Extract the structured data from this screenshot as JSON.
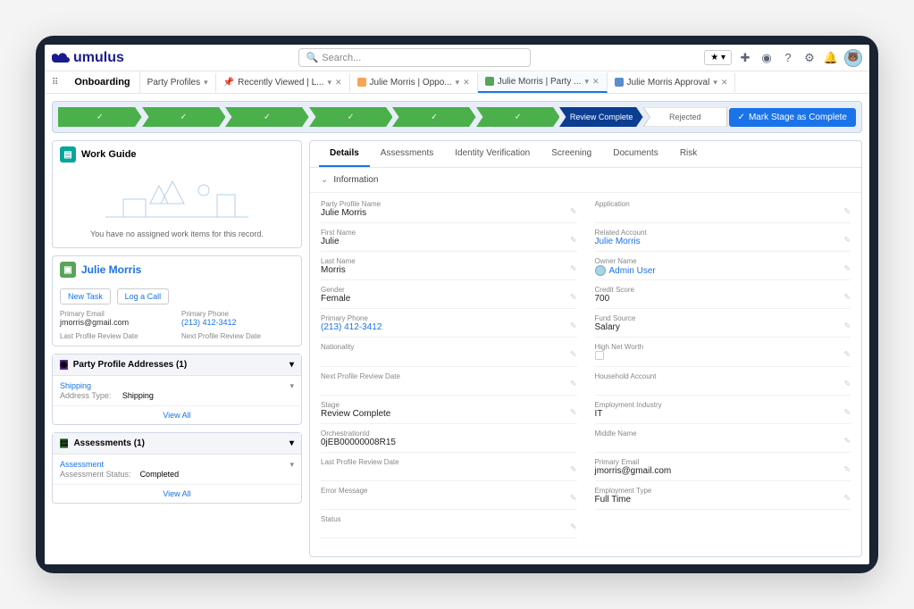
{
  "brand": "umulus",
  "search_placeholder": "Search...",
  "app_name": "Onboarding",
  "tabs": [
    {
      "label": "Party Profiles"
    },
    {
      "label": "Recently Viewed | L..."
    },
    {
      "label": "Julie Morris | Oppo..."
    },
    {
      "label": "Julie Morris | Party ..."
    },
    {
      "label": "Julie Morris Approval"
    }
  ],
  "stages": {
    "review_complete": "Review Complete",
    "rejected": "Rejected",
    "mark_complete": "Mark Stage as Complete"
  },
  "work_guide": {
    "title": "Work Guide",
    "empty": "You have no assigned work items for this record."
  },
  "contact": {
    "name": "Julie Morris",
    "new_task": "New Task",
    "log_call": "Log a Call",
    "primary_email_label": "Primary Email",
    "primary_email": "jmorris@gmail.com",
    "primary_phone_label": "Primary Phone",
    "primary_phone": "(213) 412-3412",
    "last_review_label": "Last Profile Review Date",
    "next_review_label": "Next Profile Review Date"
  },
  "addresses": {
    "title": "Party Profile Addresses (1)",
    "shipping": "Shipping",
    "addr_type_label": "Address Type:",
    "addr_type": "Shipping",
    "view_all": "View All"
  },
  "assessments": {
    "title": "Assessments (1)",
    "row_title": "Assessment",
    "status_label": "Assessment Status:",
    "status": "Completed",
    "view_all": "View All"
  },
  "detail_tabs": {
    "details": "Details",
    "assessments": "Assessments",
    "identity": "Identity Verification",
    "screening": "Screening",
    "documents": "Documents",
    "risk": "Risk"
  },
  "section_information": "Information",
  "fields": {
    "party_profile_name": {
      "label": "Party Profile Name",
      "value": "Julie Morris"
    },
    "application": {
      "label": "Application",
      "value": ""
    },
    "first_name": {
      "label": "First Name",
      "value": "Julie"
    },
    "related_account": {
      "label": "Related Account",
      "value": "Julie Morris"
    },
    "last_name": {
      "label": "Last Name",
      "value": "Morris"
    },
    "owner_name": {
      "label": "Owner Name",
      "value": "Admin User"
    },
    "gender": {
      "label": "Gender",
      "value": "Female"
    },
    "credit_score": {
      "label": "Credit Score",
      "value": "700"
    },
    "primary_phone": {
      "label": "Primary Phone",
      "value": "(213) 412-3412"
    },
    "fund_source": {
      "label": "Fund Source",
      "value": "Salary"
    },
    "nationality": {
      "label": "Nationality",
      "value": ""
    },
    "high_net_worth": {
      "label": "High Net Worth",
      "value": ""
    },
    "next_review": {
      "label": "Next Profile Review Date",
      "value": ""
    },
    "household": {
      "label": "Household Account",
      "value": ""
    },
    "stage": {
      "label": "Stage",
      "value": "Review Complete"
    },
    "employment_industry": {
      "label": "Employment Industry",
      "value": "IT"
    },
    "orchestration_id": {
      "label": "OrchestrationId",
      "value": "0jEB00000008R15"
    },
    "middle_name": {
      "label": "Middle Name",
      "value": ""
    },
    "last_review": {
      "label": "Last Profile Review Date",
      "value": ""
    },
    "primary_email": {
      "label": "Primary Email",
      "value": "jmorris@gmail.com"
    },
    "error_message": {
      "label": "Error Message",
      "value": ""
    },
    "employment_type": {
      "label": "Employment Type",
      "value": "Full Time"
    },
    "status": {
      "label": "Status",
      "value": ""
    }
  }
}
